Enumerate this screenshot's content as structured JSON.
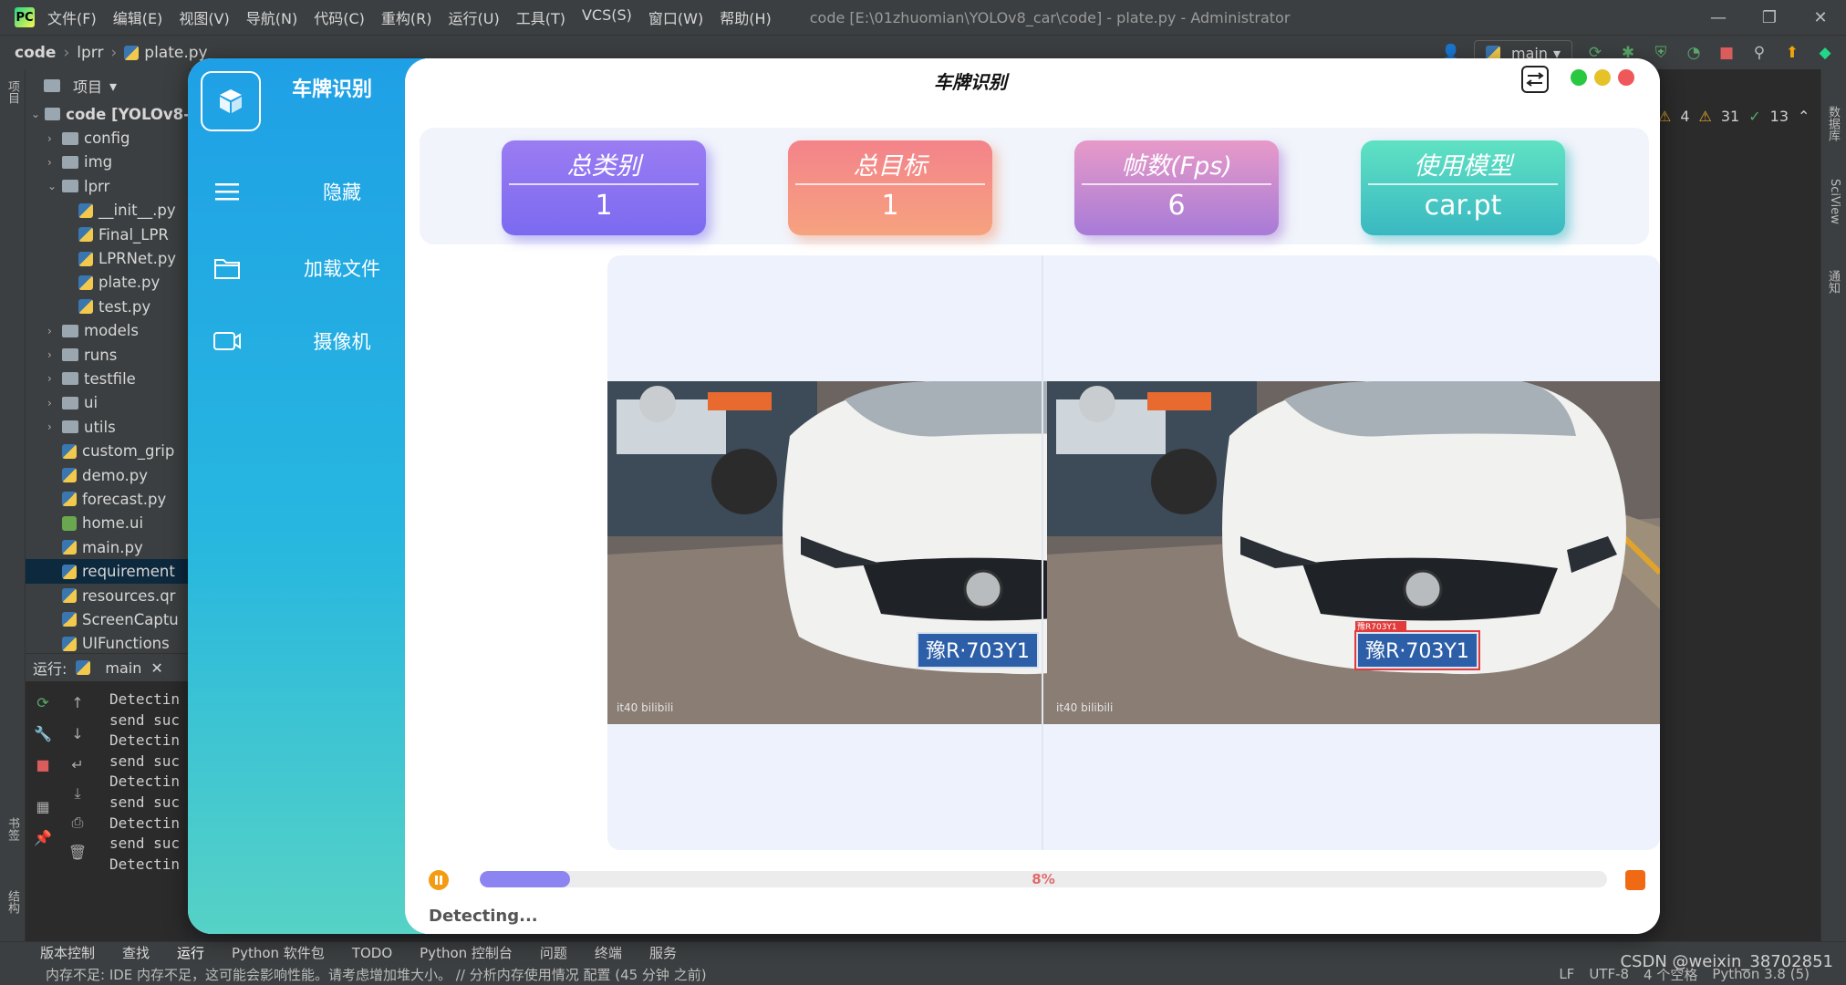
{
  "ide": {
    "menu": [
      "文件(F)",
      "编辑(E)",
      "视图(V)",
      "导航(N)",
      "代码(C)",
      "重构(R)",
      "运行(U)",
      "工具(T)",
      "VCS(S)",
      "窗口(W)",
      "帮助(H)"
    ],
    "window_title": "code [E:\\01zhuomian\\YOLOv8_car\\code] - plate.py - Administrator",
    "breadcrumb": [
      "code",
      "lprr",
      "plate.py"
    ],
    "branch": "main",
    "project_label": "项目",
    "tree": [
      {
        "label": "code [YOLOv8-",
        "depth": 0,
        "kind": "folder",
        "open": true
      },
      {
        "label": "config",
        "depth": 1,
        "kind": "folder"
      },
      {
        "label": "img",
        "depth": 1,
        "kind": "folder"
      },
      {
        "label": "lprr",
        "depth": 1,
        "kind": "folder",
        "open": true
      },
      {
        "label": "__init__.py",
        "depth": 2,
        "kind": "py"
      },
      {
        "label": "Final_LPR",
        "depth": 2,
        "kind": "py"
      },
      {
        "label": "LPRNet.py",
        "depth": 2,
        "kind": "py"
      },
      {
        "label": "plate.py",
        "depth": 2,
        "kind": "py"
      },
      {
        "label": "test.py",
        "depth": 2,
        "kind": "py"
      },
      {
        "label": "models",
        "depth": 1,
        "kind": "folder"
      },
      {
        "label": "runs",
        "depth": 1,
        "kind": "folder"
      },
      {
        "label": "testfile",
        "depth": 1,
        "kind": "folder"
      },
      {
        "label": "ui",
        "depth": 1,
        "kind": "folder"
      },
      {
        "label": "utils",
        "depth": 1,
        "kind": "folder"
      },
      {
        "label": "custom_grip",
        "depth": 1,
        "kind": "py"
      },
      {
        "label": "demo.py",
        "depth": 1,
        "kind": "py"
      },
      {
        "label": "forecast.py",
        "depth": 1,
        "kind": "py"
      },
      {
        "label": "home.ui",
        "depth": 1,
        "kind": "ui"
      },
      {
        "label": "main.py",
        "depth": 1,
        "kind": "py"
      },
      {
        "label": "requirement",
        "depth": 1,
        "kind": "py",
        "selected": true
      },
      {
        "label": "resources.qr",
        "depth": 1,
        "kind": "py"
      },
      {
        "label": "ScreenCaptu",
        "depth": 1,
        "kind": "py"
      },
      {
        "label": "UIFunctions",
        "depth": 1,
        "kind": "py"
      }
    ],
    "run_label": "运行:",
    "run_tab": "main",
    "console": [
      "Detectin",
      "send suc",
      "Detectin",
      "send suc",
      "Detectin",
      "send suc",
      "Detectin",
      "send suc",
      "Detectin"
    ],
    "inspection": {
      "warnings": "4",
      "weak": "31",
      "ok": "13"
    },
    "bottom_tabs": [
      "版本控制",
      "查找",
      "运行",
      "Python 软件包",
      "TODO",
      "Python 控制台",
      "问题",
      "终端",
      "服务"
    ],
    "status_left": "内存不足: IDE 内存不足，这可能会影响性能。请考虑增加堆大小。 // 分析内存使用情况   配置 (45 分钟 之前)",
    "status_right": [
      "LF",
      "UTF-8",
      "4 个空格",
      "Python 3.8 (5)"
    ],
    "watermark": "CSDN @weixin_38702851"
  },
  "app": {
    "name": "车牌识别",
    "title": "车牌识别",
    "sidebar": [
      {
        "label": "隐藏",
        "icon": "menu-icon"
      },
      {
        "label": "加载文件",
        "icon": "folder-icon"
      },
      {
        "label": "摄像机",
        "icon": "camera-icon"
      }
    ],
    "stats": [
      {
        "label": "总类别",
        "value": "1"
      },
      {
        "label": "总目标",
        "value": "1"
      },
      {
        "label": "帧数(Fps)",
        "value": "6"
      },
      {
        "label": "使用模型",
        "value": "car.pt"
      }
    ],
    "plate_text": "豫R·703Y1",
    "detection_label": "豫R703Y1",
    "video_watermark": "it40 bilibili",
    "progress": {
      "percent": 8,
      "label": "8%"
    },
    "status": "Detecting...",
    "colors": {
      "window_green": "#28c840",
      "window_yellow": "#e6c229",
      "window_red": "#f0575b",
      "stat1": "#7b6af0",
      "stat2": "#f6a27f",
      "stat3": "#a77bd8",
      "stat4": "#3ab8c1",
      "progress": "#8c84f0"
    }
  }
}
